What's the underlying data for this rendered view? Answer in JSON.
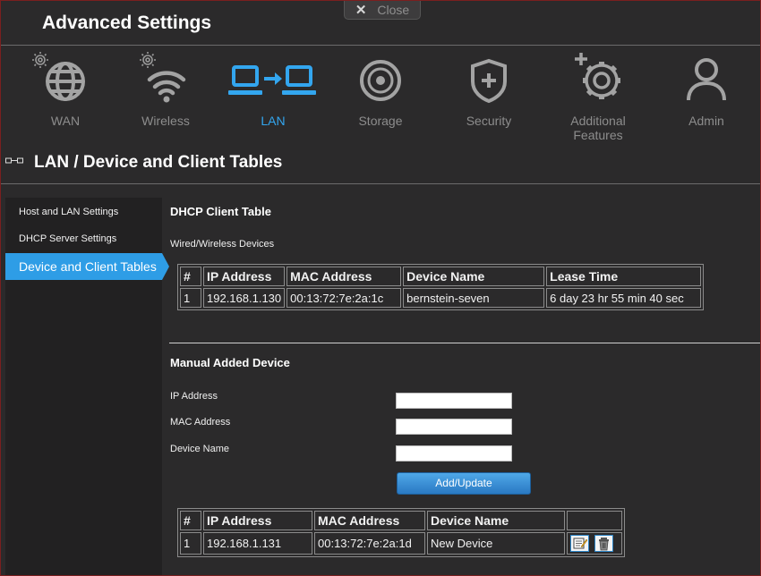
{
  "window": {
    "title": "Advanced Settings",
    "close_label": "Close"
  },
  "nav": {
    "items": [
      {
        "label": "WAN",
        "icon": "globe-icon",
        "active": false
      },
      {
        "label": "Wireless",
        "icon": "wifi-icon",
        "active": false
      },
      {
        "label": "LAN",
        "icon": "lan-computers-icon",
        "active": true
      },
      {
        "label": "Storage",
        "icon": "disc-icon",
        "active": false
      },
      {
        "label": "Security",
        "icon": "shield-icon",
        "active": false
      },
      {
        "label": "Additional Features",
        "icon": "gear-plus-icon",
        "active": false
      },
      {
        "label": "Admin",
        "icon": "user-icon",
        "active": false
      }
    ]
  },
  "section": {
    "title": "LAN / Device and Client Tables",
    "icon": "lan-mini-icon"
  },
  "sidebar": {
    "items": [
      {
        "label": "Host and LAN Settings",
        "active": false
      },
      {
        "label": "DHCP Server Settings",
        "active": false
      },
      {
        "label": "Device and Client Tables",
        "active": true
      }
    ]
  },
  "dhcp": {
    "title": "DHCP Client Table",
    "subtitle": "Wired/Wireless Devices",
    "headers": [
      "#",
      "IP Address",
      "MAC Address",
      "Device Name",
      "Lease Time"
    ],
    "rows": [
      [
        "1",
        "192.168.1.130",
        "00:13:72:7e:2a:1c",
        "bernstein-seven",
        "6 day 23 hr 55 min 40 sec"
      ]
    ]
  },
  "manual": {
    "title": "Manual Added Device",
    "ip_label": "IP Address",
    "mac_label": "MAC Address",
    "name_label": "Device Name",
    "ip_value": "",
    "mac_value": "",
    "name_value": "",
    "button_label": "Add/Update",
    "headers": [
      "#",
      "IP Address",
      "MAC Address",
      "Device Name",
      ""
    ],
    "rows": [
      [
        "1",
        "192.168.1.131",
        "00:13:72:7e:2a:1d",
        "New Device"
      ]
    ]
  },
  "colors": {
    "accent": "#2e9de6",
    "background": "#2b2a2b",
    "inactive": "#8d8d8d"
  }
}
